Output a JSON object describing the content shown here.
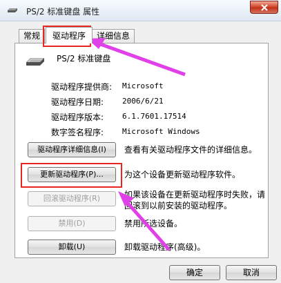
{
  "window": {
    "title": "PS/2 标准键盘 属性"
  },
  "tabs": [
    {
      "label": "常规"
    },
    {
      "label": "驱动程序"
    },
    {
      "label": "详细信息"
    }
  ],
  "device": {
    "name": "PS/2 标准键盘"
  },
  "driver_info": [
    {
      "label": "驱动程序提供商:",
      "value": "Microsoft"
    },
    {
      "label": "驱动程序日期:",
      "value": "2006/6/21"
    },
    {
      "label": "驱动程序版本:",
      "value": "6.1.7601.17514"
    },
    {
      "label": "数字签名程序:",
      "value": "Microsoft Windows"
    }
  ],
  "actions": [
    {
      "button": "驱动程序详细信息(I)",
      "desc": "查看有关驱动程序文件的详细信息。"
    },
    {
      "button": "更新驱动程序(P)...",
      "desc": "为这个设备更新驱动程序软件。"
    },
    {
      "button": "回滚驱动程序(R)",
      "desc": "如果该设备在更新驱动程序时失败，请回滚到以前安装的驱动程序。"
    },
    {
      "button": "禁用(D)",
      "desc": "禁用所选设备。"
    },
    {
      "button": "卸载(U)",
      "desc": "卸载驱动程序(高级)。"
    }
  ],
  "footer": {
    "ok": "确定",
    "cancel": "取消"
  },
  "annotation_color": "#e8251f",
  "arrow_color": "#e040e8"
}
